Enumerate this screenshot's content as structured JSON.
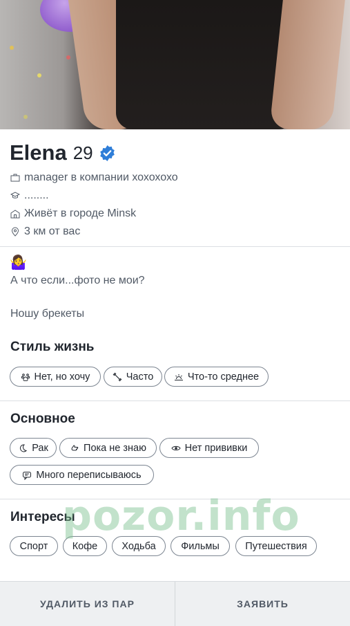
{
  "profile": {
    "name": "Elena",
    "age": "29",
    "job": "manager в компании хохохохо",
    "education": "........",
    "city": "Живёт в городе Minsk",
    "distance": "3 км от вас"
  },
  "bio": {
    "emoji": "🤷‍♀️",
    "line1": "А что если...фото не мои?",
    "line2": "Ношу брекеты"
  },
  "lifestyle": {
    "title": "Стиль жизнь",
    "chips": [
      {
        "label": "Нет, но хочу",
        "icon": "paw-icon"
      },
      {
        "label": "Часто",
        "icon": "dumbbell-icon"
      },
      {
        "label": "Что-то среднее",
        "icon": "sunrise-icon"
      }
    ]
  },
  "basics": {
    "title": "Основное",
    "chips": [
      {
        "label": "Рак",
        "icon": "moon-icon"
      },
      {
        "label": "Пока не знаю",
        "icon": "hand-icon"
      },
      {
        "label": "Нет прививки",
        "icon": "eye-icon"
      },
      {
        "label": "Много переписываюсь",
        "icon": "chat-icon"
      }
    ]
  },
  "interests": {
    "title": "Интересы",
    "chips": [
      "Спорт",
      "Кофе",
      "Ходьба",
      "Фильмы",
      "Путешествия"
    ]
  },
  "watermark": "pozor.info",
  "actions": {
    "unmatch": "УДАЛИТЬ ИЗ ПАР",
    "report": "ЗАЯВИТЬ"
  },
  "colors": {
    "verified": "#2f7ed8",
    "text": "#21262e",
    "muted": "#505965"
  }
}
